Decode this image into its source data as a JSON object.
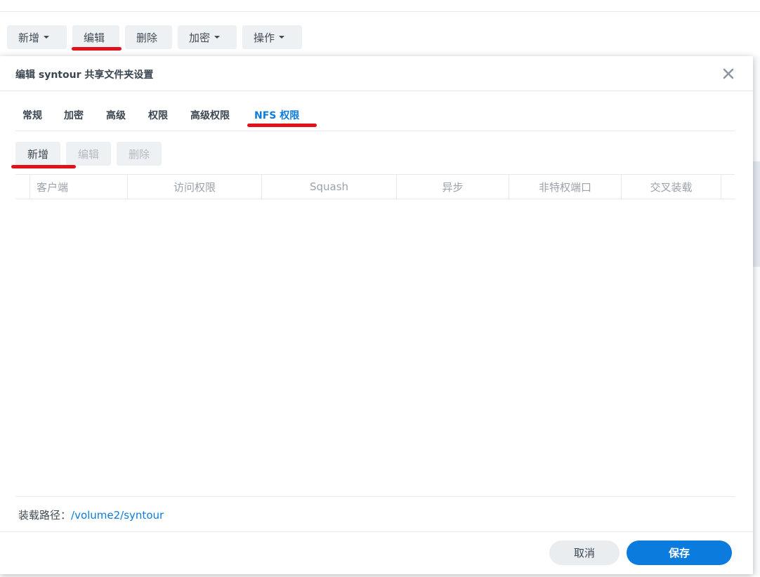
{
  "background_toolbar": {
    "buttons": [
      {
        "label": "新增",
        "has_caret": true
      },
      {
        "label": "编辑",
        "has_caret": false
      },
      {
        "label": "删除",
        "has_caret": false
      },
      {
        "label": "加密",
        "has_caret": true
      },
      {
        "label": "操作",
        "has_caret": true
      }
    ]
  },
  "dialog": {
    "title": "编辑 syntour 共享文件夹设置",
    "close_icon": "close-icon",
    "tabs": [
      {
        "label": "常规",
        "active": false
      },
      {
        "label": "加密",
        "active": false
      },
      {
        "label": "高级",
        "active": false
      },
      {
        "label": "权限",
        "active": false
      },
      {
        "label": "高级权限",
        "active": false
      },
      {
        "label": "NFS 权限",
        "active": true
      }
    ],
    "toolbar": {
      "add_label": "新增",
      "edit_label": "编辑",
      "delete_label": "删除"
    },
    "grid": {
      "columns": [
        "客户端",
        "访问权限",
        "Squash",
        "异步",
        "非特权端口",
        "交叉装载"
      ],
      "rows": []
    },
    "mount_path": {
      "label": "装载路径：",
      "value": "/volume2/syntour"
    },
    "footer": {
      "cancel_label": "取消",
      "save_label": "保存"
    }
  },
  "colors": {
    "accent": "#0b7cde",
    "marker": "#e2121b",
    "button_bg": "#eef1f4"
  }
}
